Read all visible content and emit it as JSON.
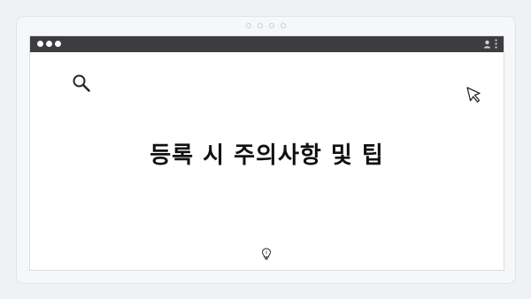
{
  "headline": "등록 시 주의사항 및 팁",
  "icons": {
    "search": "search-icon",
    "cursor": "cursor-arrow-icon",
    "lightbulb": "lightbulb-icon",
    "profile": "profile-icon",
    "menu": "kebab-menu-icon"
  },
  "colors": {
    "titlebar": "#3d3d40",
    "text": "#111111",
    "background": "#eff2f5"
  }
}
